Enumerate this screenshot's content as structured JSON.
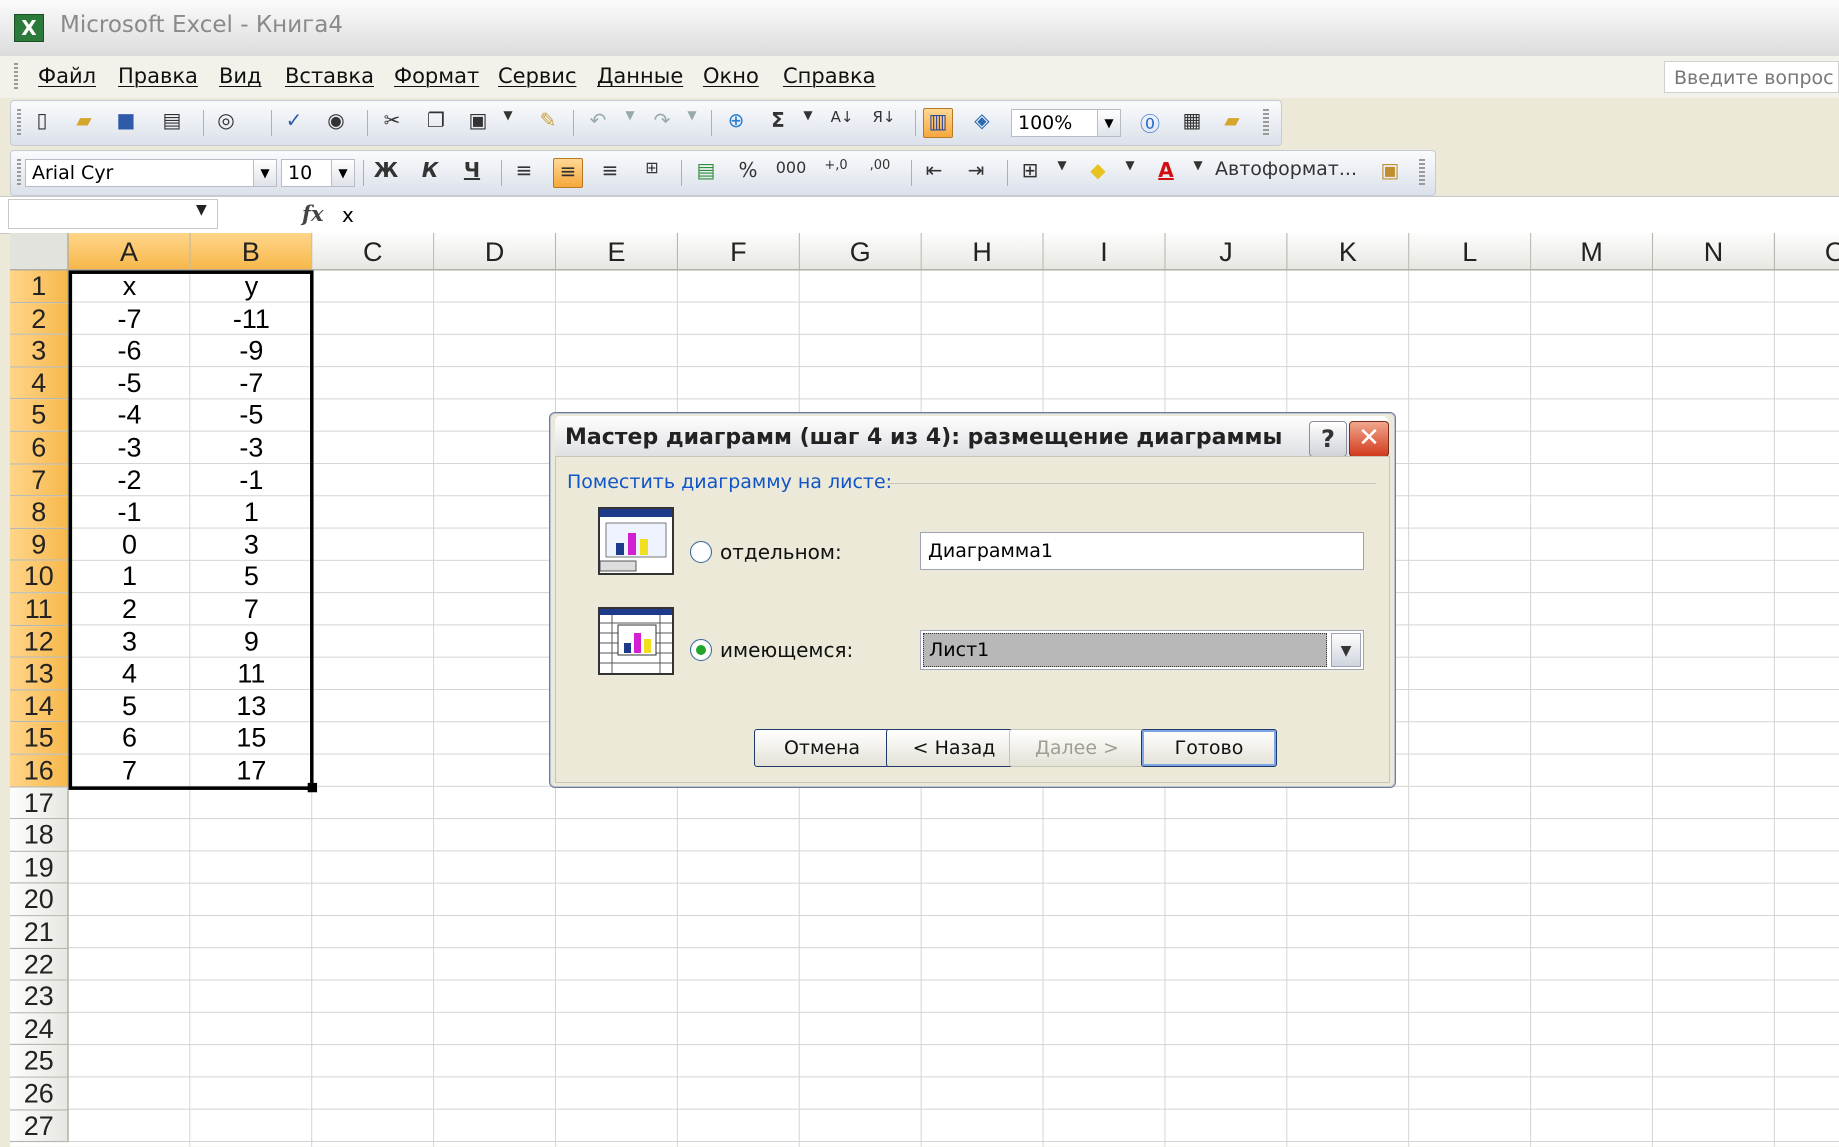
{
  "window": {
    "title": "Microsoft Excel - Книга4",
    "app_icon": "X"
  },
  "menu": {
    "items": [
      "Файл",
      "Правка",
      "Вид",
      "Вставка",
      "Формат",
      "Сервис",
      "Данные",
      "Окно",
      "Справка"
    ],
    "ask_placeholder": "Введите вопрос"
  },
  "toolbar_standard": {
    "zoom": "100%",
    "sum_glyph": "Σ"
  },
  "toolbar_format": {
    "font": "Arial Cyr",
    "size": "10",
    "bold": "Ж",
    "italic": "К",
    "underline": "Ч",
    "percent": "%",
    "thousands": "000",
    "inc_dec": "+,0",
    "dec_dec": ",00",
    "autoformat": "Автоформат..."
  },
  "formula_bar": {
    "name_box": "",
    "fx": "fx",
    "value": "x"
  },
  "sheet": {
    "columns": [
      "A",
      "B",
      "C",
      "D",
      "E",
      "F",
      "G",
      "H",
      "I",
      "J",
      "K",
      "L",
      "M",
      "N",
      "O"
    ],
    "rows": [
      "1",
      "2",
      "3",
      "4",
      "5",
      "6",
      "7",
      "8",
      "9",
      "10",
      "11",
      "12",
      "13",
      "14",
      "15",
      "16",
      "17",
      "18",
      "19",
      "20",
      "21",
      "22",
      "23",
      "24",
      "25",
      "26",
      "27"
    ],
    "col_a": [
      "x",
      "-7",
      "-6",
      "-5",
      "-4",
      "-3",
      "-2",
      "-1",
      "0",
      "1",
      "2",
      "3",
      "4",
      "5",
      "6",
      "7"
    ],
    "col_b": [
      "y",
      "-11",
      "-9",
      "-7",
      "-5",
      "-3",
      "-1",
      "1",
      "3",
      "5",
      "7",
      "9",
      "11",
      "13",
      "15",
      "17"
    ]
  },
  "dialog": {
    "title": "Мастер диаграмм (шаг 4 из 4): размещение диаграммы",
    "help": "?",
    "close": "✕",
    "group_label": "Поместить диаграмму на листе:",
    "option_new": "отдельном:",
    "option_existing": "имеющемся:",
    "new_sheet_value": "Диаграмма1",
    "existing_sheet_value": "Лист1",
    "selected_option": "existing",
    "buttons": {
      "cancel": "Отмена",
      "back": "< Назад",
      "next": "Далее >",
      "finish": "Готово"
    }
  }
}
